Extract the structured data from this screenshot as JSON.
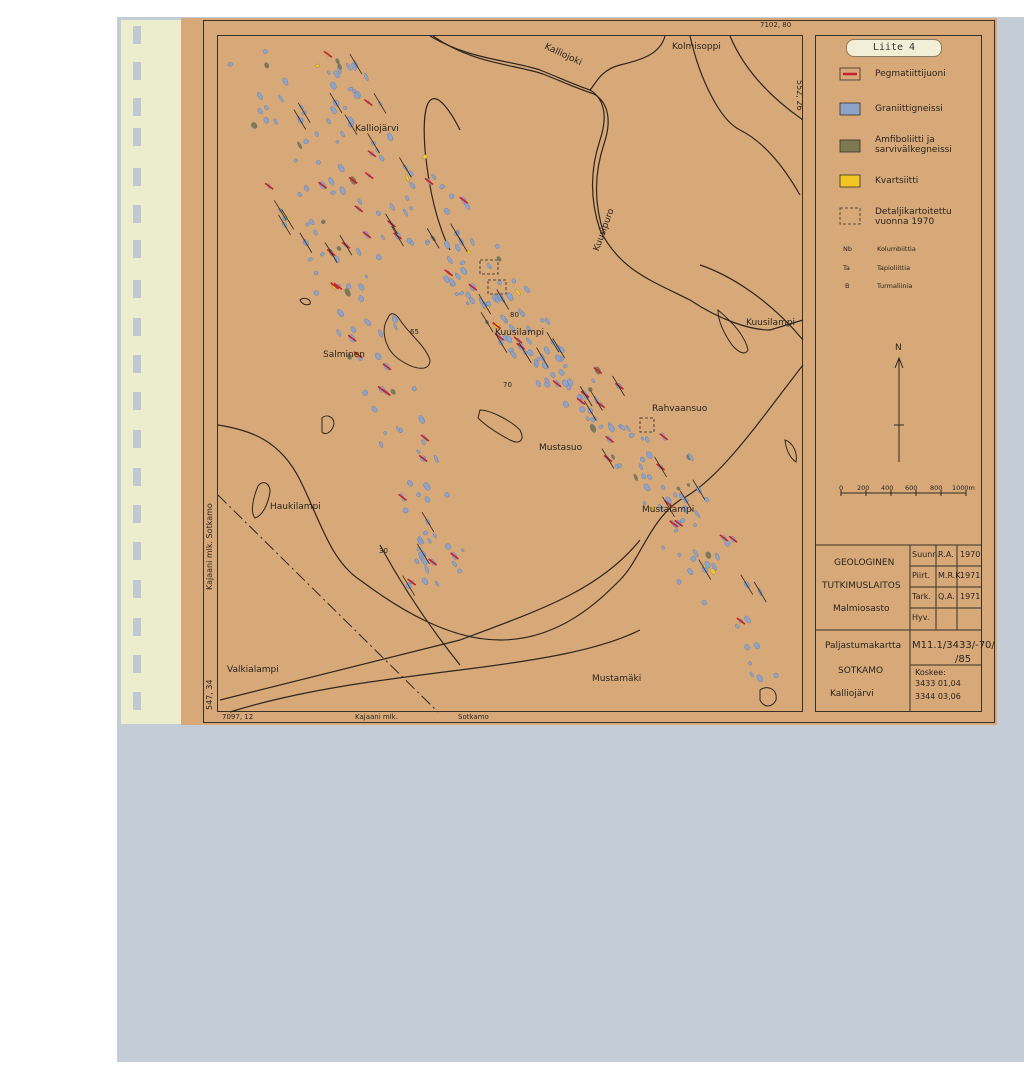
{
  "sheet_label": "Liite 4",
  "legend": {
    "items": [
      {
        "label": "Pegmatiittijuoni",
        "color": "#c8202c"
      },
      {
        "label": "Graniittigneissi",
        "color": "#8ea3c8"
      },
      {
        "label": "Amfiboliitti ja sarvivälkegneissi",
        "line1": "Amfiboliitti ja",
        "line2": "sarvivälkegneissi",
        "color": "#7d7a52"
      },
      {
        "label": "Kvartsiitti",
        "color": "#f2c623"
      },
      {
        "label": "Detaljikartoitettu vuonna 1970",
        "line1": "Detaljikartoitettu",
        "line2": "vuonna 1970"
      }
    ],
    "abbreviations": [
      {
        "code": "Nb",
        "name": "Kolumbiittia"
      },
      {
        "code": "Ta",
        "name": "Tapioliittia"
      },
      {
        "code": "B",
        "name": "Turmaliinia"
      }
    ],
    "north": "N",
    "scale_ticks": [
      "0",
      "200",
      "400",
      "600",
      "800",
      "1000m"
    ]
  },
  "places": {
    "kolmisoppi": "Kolmisoppi",
    "kalliojoki": "Kalliojoki",
    "kalliojarvi": "Kalliojärvi",
    "kuusipuro": "Kuusipuro",
    "kuusilampi_e": "Kuusilampi",
    "kuusilampi_c": "Kuusilampi",
    "salminen": "Salminen",
    "rahvaansuo": "Rahvaansuo",
    "mustasuo": "Mustasuo",
    "haukilampi": "Haukilampi",
    "mustalampi": "Mustalampi",
    "valkialampi": "Valkialampi",
    "mustamaki": "Mustamäki"
  },
  "map_labels": {
    "coord_top": "7102, 80",
    "coord_right": "552, 26",
    "coord_bottom_left": "7097, 12",
    "coord_left": "547, 34",
    "boundary_left": "Kajaani  mlk.      Sotkamo",
    "boundary_bottom_a": "Kajaani  mlk.",
    "boundary_bottom_b": "Sotkamo",
    "num_65": "65",
    "num_80": "80",
    "num_70": "70",
    "num_30": "30"
  },
  "title_block": {
    "org_1": "GEOLOGINEN",
    "org_2": "TUTKIMUSLAITOS",
    "org_3": "Malmiosasto",
    "rows": [
      {
        "role": "Suunn.",
        "name": "R.A.",
        "year": "1970"
      },
      {
        "role": "Piirt.",
        "name": "M.R.K.",
        "year": "1971"
      },
      {
        "role": "Tark.",
        "name": "Q.A.",
        "year": "1971"
      },
      {
        "role": "Hyv.",
        "name": "",
        "year": ""
      }
    ],
    "map_type": "Paljastumakartta",
    "region": "SOTKAMO",
    "area": "Kalliojärvi",
    "map_number_1": "M11.1/3433/-70/",
    "map_number_2": "/85",
    "koskee_label": "Koskee:",
    "koskee_1": "3433  01,04",
    "koskee_2": "3344  03,06"
  }
}
